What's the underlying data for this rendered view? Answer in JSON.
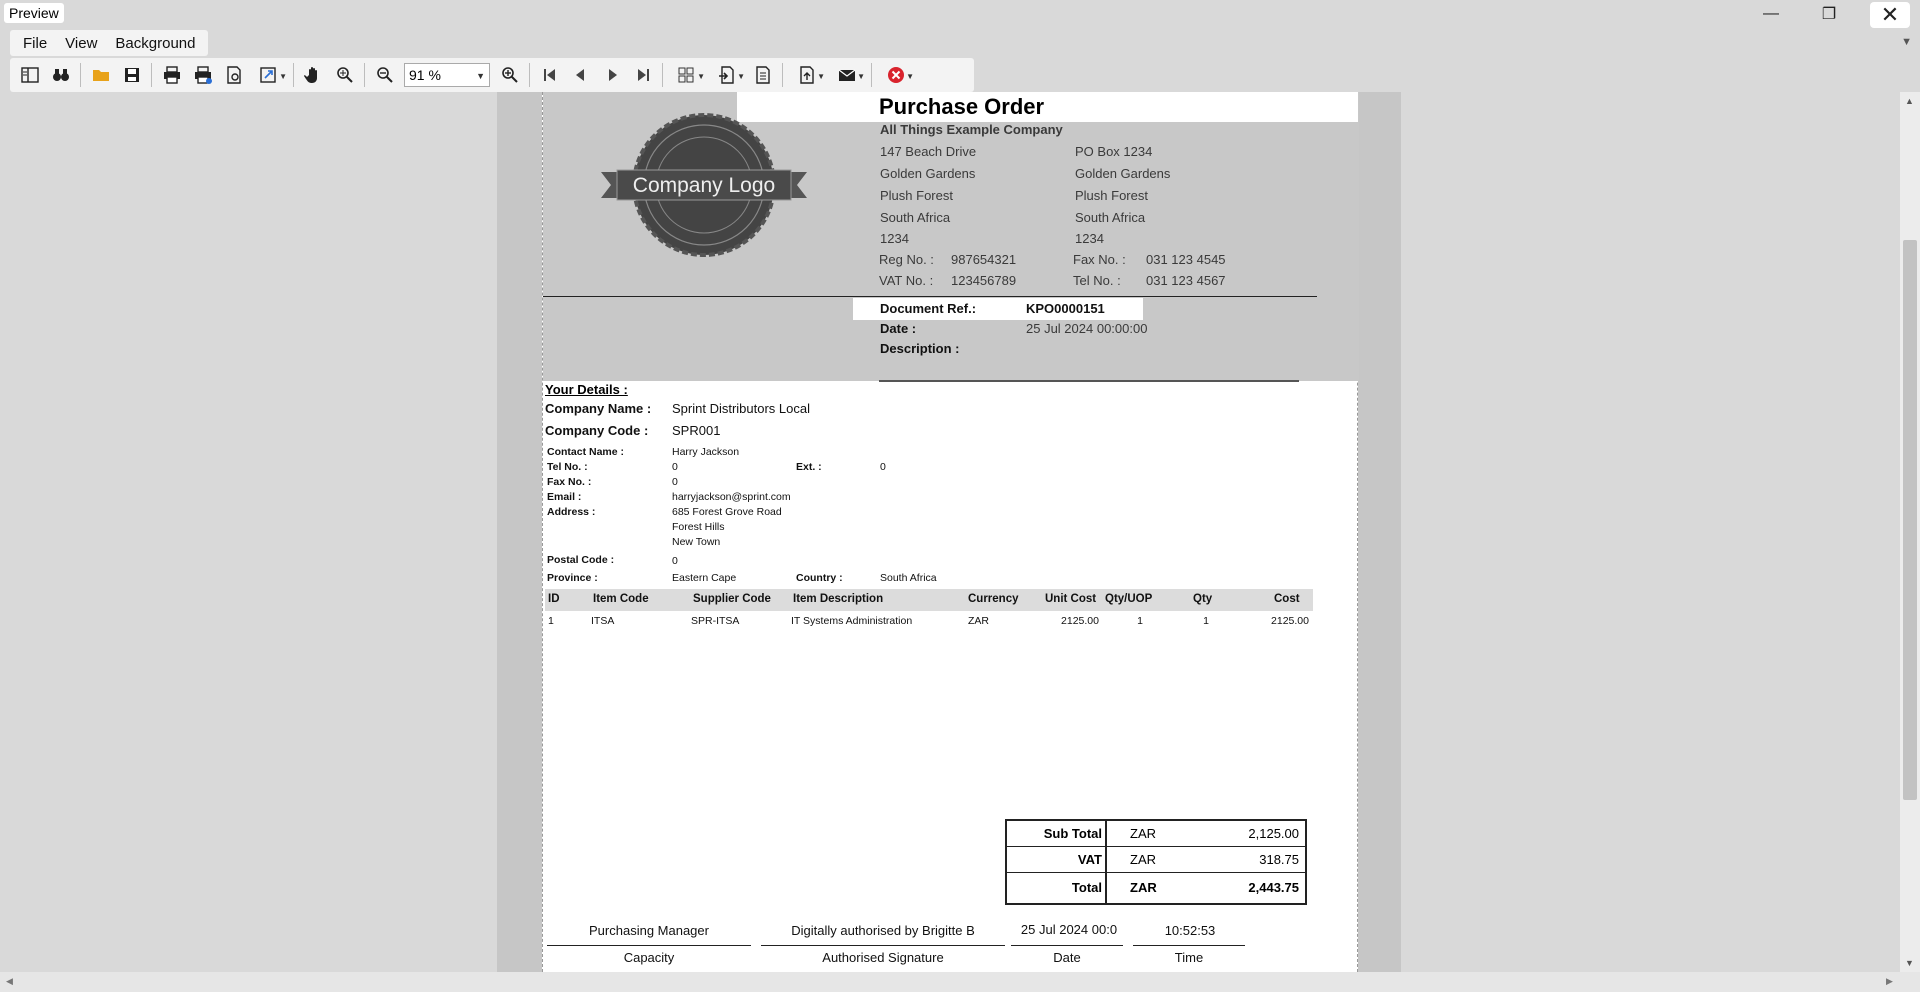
{
  "window": {
    "title": "Preview"
  },
  "menu": [
    "File",
    "View",
    "Background"
  ],
  "toolbar": {
    "zoom": "91 %"
  },
  "report": {
    "title": "Purchase Order",
    "company": "All Things Example Company",
    "street": [
      "147 Beach Drive",
      "Golden Gardens",
      "Plush Forest",
      "South Africa",
      "1234"
    ],
    "postal": [
      "PO Box 1234",
      "Golden Gardens",
      "Plush Forest",
      "South Africa",
      "1234"
    ],
    "reg_label": "Reg No. :",
    "reg_value": "987654321",
    "vat_label": "VAT No. :",
    "vat_value": "123456789",
    "fax_label": "Fax No. :",
    "fax_value": "031 123 4545",
    "tel_label": "Tel No. :",
    "tel_value": "031 123 4567",
    "docref_label": "Document Ref.:",
    "docref_value": "KPO0000151",
    "date_label": "Date :",
    "date_value": "25 Jul 2024 00:00:00",
    "desc_label": "Description :",
    "details_title": "Your Details :",
    "company_name_label": "Company Name :",
    "company_name": "Sprint Distributors Local",
    "company_code_label": "Company Code :",
    "company_code": "SPR001",
    "contact_label": "Contact Name :",
    "contact": "Harry Jackson",
    "tel2_label": "Tel No. :",
    "tel2": "0",
    "ext_label": "Ext. :",
    "ext": "0",
    "fax2_label": "Fax No. :",
    "fax2": "0",
    "email_label": "Email :",
    "email": "harryjackson@sprint.com",
    "address_label": "Address :",
    "address": [
      "685 Forest Grove Road",
      "Forest Hills",
      "New Town"
    ],
    "postal_code_label": "Postal Code :",
    "postal_code": "0",
    "province_label": "Province :",
    "province": "Eastern Cape",
    "country_label": "Country :",
    "country": "South Africa",
    "columns": [
      "ID",
      "Item Code",
      "Supplier Code",
      "Item Description",
      "Currency",
      "Unit Cost",
      "Qty/UOP",
      "Qty",
      "Cost"
    ],
    "rows": [
      [
        "1",
        "ITSA",
        "SPR-ITSA",
        "IT Systems Administration",
        "ZAR",
        "2125.00",
        "1",
        "1",
        "2125.00"
      ]
    ],
    "totals": [
      {
        "label": "Sub Total",
        "currency": "ZAR",
        "amount": "2,125.00"
      },
      {
        "label": "VAT",
        "currency": "ZAR",
        "amount": "318.75"
      },
      {
        "label": "Total",
        "currency": "ZAR",
        "amount": "2,443.75"
      }
    ],
    "sign": {
      "capacity_value": "Purchasing Manager",
      "signature_value": "Digitally authorised by Brigitte B",
      "date_value": "25 Jul 2024 00:0",
      "time_value": "10:52:53",
      "capacity_label": "Capacity",
      "signature_label": "Authorised Signature",
      "date_label": "Date",
      "time_label": "Time"
    },
    "logo_text": "Company Logo"
  }
}
